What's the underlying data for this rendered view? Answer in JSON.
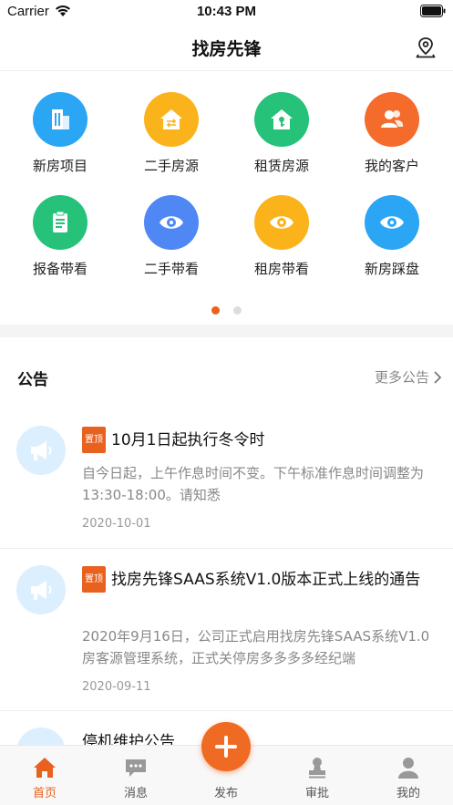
{
  "status_bar": {
    "carrier": "Carrier",
    "time": "10:43 PM"
  },
  "nav": {
    "title": "找房先锋",
    "location_icon": "location-pin-icon"
  },
  "grid": [
    {
      "label": "新房项目",
      "icon": "building-icon",
      "color": "#2aa6f5"
    },
    {
      "label": "二手房源",
      "icon": "house-exchange-icon",
      "color": "#fbb31c"
    },
    {
      "label": "租赁房源",
      "icon": "house-key-icon",
      "color": "#26c27a"
    },
    {
      "label": "我的客户",
      "icon": "users-icon",
      "color": "#f46b2c"
    },
    {
      "label": "报备带看",
      "icon": "clipboard-icon",
      "color": "#26c27a"
    },
    {
      "label": "二手带看",
      "icon": "eye-icon",
      "color": "#4f88f5"
    },
    {
      "label": "租房带看",
      "icon": "eye-icon",
      "color": "#fbb31c"
    },
    {
      "label": "新房踩盘",
      "icon": "eye-icon",
      "color": "#2aa6f5"
    }
  ],
  "pager": {
    "active_color": "#e8611f",
    "inactive_color": "#dddddd",
    "page": 1,
    "pages": 2
  },
  "notices": {
    "title": "公告",
    "more_label": "更多公告",
    "pin_label": "置顶",
    "items": [
      {
        "title": "10月1日起执行冬令时",
        "body": "自今日起，上午作息时间不变。下午标准作息时间调整为13:30-18:00。请知悉",
        "date": "2020-10-01",
        "pinned": true
      },
      {
        "title": "找房先锋SAAS系统V1.0版本正式上线的通告",
        "body": "2020年9月16日，公司正式启用找房先锋SAAS系统V1.0房客源管理系统，正式关停房多多多多经纪端",
        "date": "2020-09-11",
        "pinned": true
      },
      {
        "title": "停机维护公告",
        "pinned": false
      }
    ]
  },
  "tabs": [
    {
      "label": "首页",
      "icon": "home-icon",
      "active": true
    },
    {
      "label": "消息",
      "icon": "message-icon",
      "active": false
    },
    {
      "label": "发布",
      "icon": "plus-icon",
      "active": false
    },
    {
      "label": "审批",
      "icon": "approval-icon",
      "active": false
    },
    {
      "label": "我的",
      "icon": "profile-icon",
      "active": false
    }
  ],
  "colors": {
    "accent": "#e8611f",
    "avatar_bg": "#dcefff",
    "megaphone": "#ffffff"
  }
}
